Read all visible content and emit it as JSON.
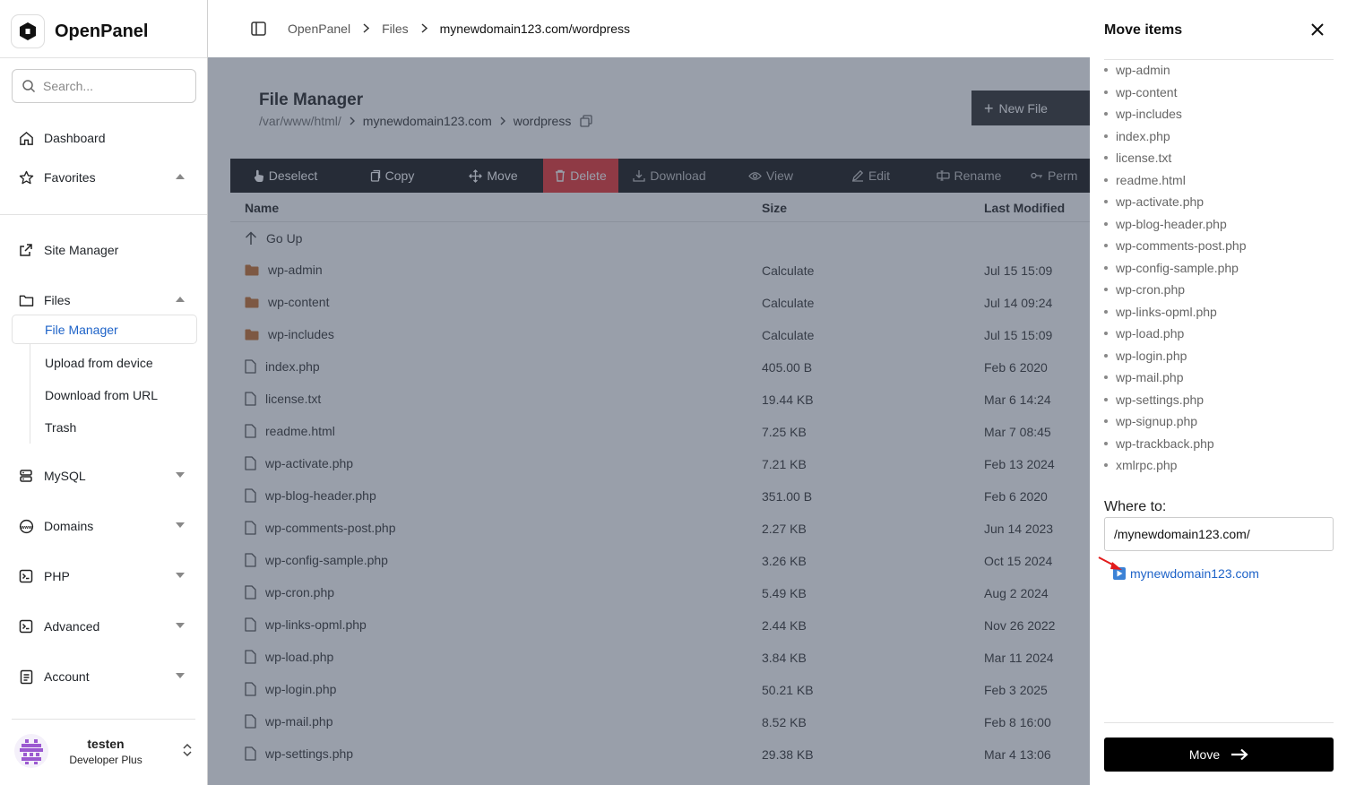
{
  "app": {
    "name": "OpenPanel"
  },
  "sidebar": {
    "search_placeholder": "Search...",
    "items": [
      {
        "label": "Dashboard",
        "icon": "home-icon"
      },
      {
        "label": "Favorites",
        "icon": "star-icon"
      },
      {
        "label": "Site Manager",
        "icon": "external-link-icon"
      },
      {
        "label": "Files",
        "icon": "folder-icon"
      },
      {
        "label": "MySQL",
        "icon": "database-icon"
      },
      {
        "label": "Domains",
        "icon": "globe-icon"
      },
      {
        "label": "PHP",
        "icon": "terminal-icon"
      },
      {
        "label": "Advanced",
        "icon": "terminal-icon"
      },
      {
        "label": "Account",
        "icon": "document-icon"
      }
    ],
    "files_sub": [
      "File Manager",
      "Upload from device",
      "Download from URL",
      "Trash"
    ],
    "user": {
      "name": "testen",
      "plan": "Developer Plus"
    }
  },
  "breadcrumb": [
    "OpenPanel",
    "Files",
    "mynewdomain123.com/wordpress"
  ],
  "file_manager": {
    "title": "File Manager",
    "path": [
      "/var/www/html/",
      "mynewdomain123.com",
      "wordpress"
    ],
    "new_file_label": "New File",
    "toolbar": [
      "Deselect",
      "Copy",
      "Move",
      "Delete",
      "Download",
      "View",
      "Edit",
      "Rename",
      "Perm"
    ],
    "columns": {
      "name": "Name",
      "size": "Size",
      "modified": "Last Modified"
    },
    "go_up_label": "Go Up",
    "rows": [
      {
        "name": "wp-admin",
        "size": "Calculate",
        "modified": "Jul 15 15:09",
        "type": "folder"
      },
      {
        "name": "wp-content",
        "size": "Calculate",
        "modified": "Jul 14 09:24",
        "type": "folder"
      },
      {
        "name": "wp-includes",
        "size": "Calculate",
        "modified": "Jul 15 15:09",
        "type": "folder"
      },
      {
        "name": "index.php",
        "size": "405.00 B",
        "modified": "Feb 6 2020",
        "type": "file"
      },
      {
        "name": "license.txt",
        "size": "19.44 KB",
        "modified": "Mar 6 14:24",
        "type": "file"
      },
      {
        "name": "readme.html",
        "size": "7.25 KB",
        "modified": "Mar 7 08:45",
        "type": "file"
      },
      {
        "name": "wp-activate.php",
        "size": "7.21 KB",
        "modified": "Feb 13 2024",
        "type": "file"
      },
      {
        "name": "wp-blog-header.php",
        "size": "351.00 B",
        "modified": "Feb 6 2020",
        "type": "file"
      },
      {
        "name": "wp-comments-post.php",
        "size": "2.27 KB",
        "modified": "Jun 14 2023",
        "type": "file"
      },
      {
        "name": "wp-config-sample.php",
        "size": "3.26 KB",
        "modified": "Oct 15 2024",
        "type": "file"
      },
      {
        "name": "wp-cron.php",
        "size": "5.49 KB",
        "modified": "Aug 2 2024",
        "type": "file"
      },
      {
        "name": "wp-links-opml.php",
        "size": "2.44 KB",
        "modified": "Nov 26 2022",
        "type": "file"
      },
      {
        "name": "wp-load.php",
        "size": "3.84 KB",
        "modified": "Mar 11 2024",
        "type": "file"
      },
      {
        "name": "wp-login.php",
        "size": "50.21 KB",
        "modified": "Feb 3 2025",
        "type": "file"
      },
      {
        "name": "wp-mail.php",
        "size": "8.52 KB",
        "modified": "Feb 8 16:00",
        "type": "file"
      },
      {
        "name": "wp-settings.php",
        "size": "29.38 KB",
        "modified": "Mar 4 13:06",
        "type": "file"
      }
    ]
  },
  "move_dialog": {
    "title": "Move items",
    "items": [
      "wp-admin",
      "wp-content",
      "wp-includes",
      "index.php",
      "license.txt",
      "readme.html",
      "wp-activate.php",
      "wp-blog-header.php",
      "wp-comments-post.php",
      "wp-config-sample.php",
      "wp-cron.php",
      "wp-links-opml.php",
      "wp-load.php",
      "wp-login.php",
      "wp-mail.php",
      "wp-settings.php",
      "wp-signup.php",
      "wp-trackback.php",
      "xmlrpc.php"
    ],
    "where_label": "Where to:",
    "destination_value": "/mynewdomain123.com/",
    "suggestion": "mynewdomain123.com",
    "move_button": "Move"
  },
  "colors": {
    "accent": "#1e63c8",
    "delete": "#e81f1f",
    "folder": "#c0621c",
    "toolbar": "#000000"
  }
}
